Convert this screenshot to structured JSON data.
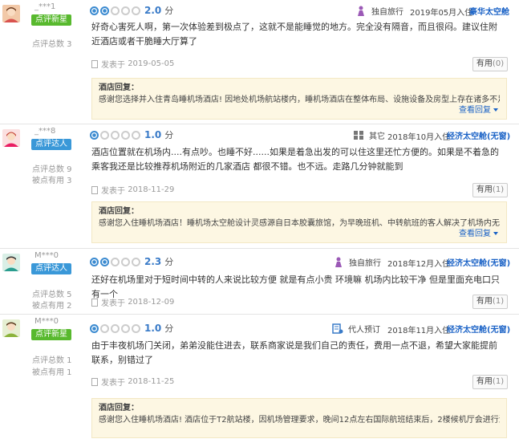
{
  "labels": {
    "score_unit": "分",
    "posted_prefix": "发表于",
    "useful": "有用",
    "reply_title": "酒店回复：",
    "more": "查看回复",
    "review_count": "点评总数",
    "useful_count": "被点有用"
  },
  "reviews": [
    {
      "user": "_***1",
      "badge": "点评新星",
      "badge_color": "green",
      "stats": [
        "点评总数 3"
      ],
      "rating_on": 2,
      "score": "2.0",
      "trip_type": "独自旅行",
      "trip_icon": "person-icon",
      "date": "2019年05月入住",
      "room": "豪华太空舱",
      "content": "好奇心害死人啊，第一次体验差到极点了，这就不是能睡觉的地方。完全没有隔音，而且很闷。建议住附近酒店或者干脆睡大厅算了",
      "posted": "2019-05-05",
      "useful_count": "0",
      "reply": "感谢您选择并入住青岛睡机场酒店! 因地处机场航站楼内，睡机场酒店在整体布局、设施设备及房型上存在诸多不足之"
    },
    {
      "user": "_***8",
      "badge": "点评达人",
      "badge_color": "blue",
      "stats": [
        "点评总数 9",
        "被点有用 3"
      ],
      "rating_on": 1,
      "score": "1.0",
      "trip_type": "其它",
      "trip_icon": "grid-icon",
      "date": "2018年10月入住",
      "room": "经济太空舱(无窗)",
      "content": "酒店位置就在机场内....有点吵。也睡不好......如果是着急出发的可以住这里还忙方便的。如果是不着急的乘客我还是比较推荐机场附近的几家酒店 都很不错。也不远。走路几分钟就能到",
      "posted": "2018-11-29",
      "useful_count": "1",
      "reply": "感谢您入住睡机场酒店！睡机场太空舱设计灵感源自日本胶囊旅馆，为早晚班机、中转航班的客人解决了机场内无法躺休"
    },
    {
      "user": "M***0",
      "badge": "点评达人",
      "badge_color": "blue",
      "stats": [
        "点评总数 5",
        "被点有用 2"
      ],
      "rating_on": 2,
      "score": "2.3",
      "trip_type": "独自旅行",
      "trip_icon": "person-icon",
      "date": "2018年12月入住",
      "room": "经济太空舱(无窗)",
      "content": "还好在机场里对于短时间中转的人来说比较方便 就是有点小贵 环境嘛 机场内比较干净 但是里面充电口只有一个",
      "posted": "2018-12-09",
      "useful_count": "1",
      "reply": ""
    },
    {
      "user": "M***0",
      "badge": "点评新星",
      "badge_color": "green",
      "stats": [
        "点评总数 1",
        "被点有用 1"
      ],
      "rating_on": 1,
      "score": "1.0",
      "trip_type": "代人预订",
      "trip_icon": "booking-icon",
      "date": "2018年11月入住",
      "room": "经济太空舱(无窗)",
      "content": "由于丰夜机场门关闭，弟弟没能住进去，联系商家说是我们自己的责任，费用一点不退，希望大家能提前联系，别错过了",
      "posted": "2018-11-25",
      "useful_count": "1",
      "reply": "感谢您入住睡机场酒店! 酒店位于T2航站楼，因机场管理要求，晚间12点左右国际航班结束后，2楼候机厅会进行清场管"
    }
  ]
}
